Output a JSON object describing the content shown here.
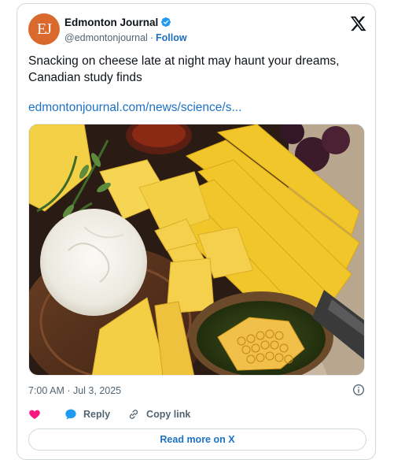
{
  "author": {
    "avatar_text": "EJ",
    "display_name": "Edmonton Journal",
    "handle": "@edmontonjournal",
    "separator": "·",
    "follow_label": "Follow",
    "avatar_color": "#d9692d"
  },
  "tweet": {
    "text": "Snacking on cheese late at night may haunt your dreams, Canadian study finds",
    "link": "edmontonjournal.com/news/science/s...",
    "timestamp": "7:00 AM · Jul 3, 2025"
  },
  "actions": {
    "reply_label": "Reply",
    "copy_link_label": "Copy link"
  },
  "footer": {
    "read_more_label": "Read more on X"
  },
  "icons": [
    "verified-badge-icon",
    "x-logo-icon",
    "info-icon",
    "heart-icon",
    "reply-bubble-icon",
    "link-icon"
  ],
  "colors": {
    "link": "#1d72c4",
    "verified": "#1d9bf0",
    "heart": "#f91880",
    "secondary_text": "#536471"
  }
}
